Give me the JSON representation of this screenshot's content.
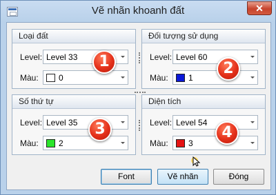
{
  "window": {
    "title": "Vẽ nhãn khoanh đất",
    "close_glyph": "✕"
  },
  "panels": [
    {
      "title": "Loại đất",
      "level_label": "Level:",
      "level_value": "Level 33",
      "color_label": "Màu:",
      "color_value": "0",
      "swatch_color": "#ffffff",
      "badge": "1"
    },
    {
      "title": "Đối tượng sử dụng",
      "level_label": "Level:",
      "level_value": "Level 60",
      "color_label": "Màu:",
      "color_value": "1",
      "swatch_color": "#0a18d8",
      "badge": "2"
    },
    {
      "title": "Số thứ tự",
      "level_label": "Level:",
      "level_value": "Level 35",
      "color_label": "Màu:",
      "color_value": "2",
      "swatch_color": "#2be52b",
      "badge": "3"
    },
    {
      "title": "Diện tích",
      "level_label": "Level:",
      "level_value": "Level 54",
      "color_label": "Màu:",
      "color_value": "3",
      "swatch_color": "#e51313",
      "badge": "4"
    }
  ],
  "buttons": {
    "font": "Font",
    "draw": "Vẽ nhãn",
    "close": "Đóng"
  }
}
